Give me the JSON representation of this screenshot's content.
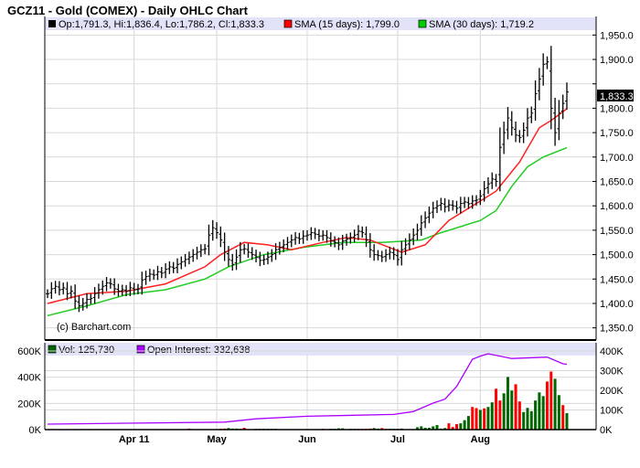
{
  "chart_data": {
    "type": "ohlc",
    "title": "GCZ11 - Gold (COMEX) - Daily OHLC Chart",
    "watermark": "(c) Barchart.com",
    "legend": {
      "ohlc": "Op:1,791.3, Hi:1,836.4, Lo:1,786.2, Cl:1,833.3",
      "sma15": "SMA (15 days): 1,799.0",
      "sma30": "SMA (30 days): 1,719.2",
      "vol": "Vol: 125,730",
      "oi": "Open Interest: 332,638"
    },
    "last_price_label": "1,833.3",
    "last_price": 1833.3,
    "price_ylim": [
      1325,
      1960
    ],
    "price_ticks": [
      1350,
      1400,
      1450,
      1500,
      1550,
      1600,
      1650,
      1700,
      1750,
      1800,
      1850,
      1900,
      1950
    ],
    "price_tick_labels": [
      "1,350.0",
      "1,400.0",
      "1,450.0",
      "1,500.0",
      "1,550.0",
      "1,600.0",
      "1,650.0",
      "1,700.0",
      "1,750.0",
      "1,800.0",
      "",
      "1,900.0",
      "1,950.0"
    ],
    "x_labels": [
      {
        "label": "Apr 11",
        "index": 22
      },
      {
        "label": "May",
        "index": 43
      },
      {
        "label": "Jun",
        "index": 66
      },
      {
        "label": "Jul",
        "index": 89
      },
      {
        "label": "Aug",
        "index": 110
      }
    ],
    "closes": [
      1420,
      1430,
      1435,
      1428,
      1432,
      1420,
      1425,
      1405,
      1395,
      1400,
      1408,
      1410,
      1420,
      1428,
      1435,
      1442,
      1440,
      1430,
      1425,
      1428,
      1425,
      1432,
      1428,
      1430,
      1448,
      1455,
      1460,
      1458,
      1465,
      1462,
      1470,
      1475,
      1472,
      1480,
      1485,
      1490,
      1495,
      1500,
      1505,
      1510,
      1512,
      1540,
      1555,
      1545,
      1530,
      1505,
      1490,
      1480,
      1495,
      1510,
      1512,
      1505,
      1500,
      1495,
      1488,
      1490,
      1495,
      1500,
      1510,
      1515,
      1520,
      1525,
      1530,
      1535,
      1532,
      1538,
      1540,
      1545,
      1542,
      1538,
      1540,
      1535,
      1528,
      1525,
      1520,
      1528,
      1532,
      1535,
      1540,
      1548,
      1545,
      1530,
      1510,
      1500,
      1498,
      1495,
      1500,
      1505,
      1500,
      1490,
      1510,
      1520,
      1530,
      1540,
      1550,
      1565,
      1575,
      1585,
      1595,
      1600,
      1605,
      1598,
      1602,
      1600,
      1595,
      1605,
      1608,
      1604,
      1610,
      1612,
      1620,
      1635,
      1645,
      1655,
      1650,
      1720,
      1750,
      1780,
      1760,
      1745,
      1740,
      1755,
      1780,
      1790,
      1830,
      1860,
      1890,
      1895,
      1800,
      1750,
      1790,
      1810,
      1833.3
    ],
    "bar_half_range": 9,
    "sma15": [
      [
        0,
        1400
      ],
      [
        10,
        1420
      ],
      [
        20,
        1425
      ],
      [
        30,
        1440
      ],
      [
        40,
        1475
      ],
      [
        44,
        1500
      ],
      [
        50,
        1525
      ],
      [
        56,
        1520
      ],
      [
        62,
        1510
      ],
      [
        70,
        1525
      ],
      [
        76,
        1535
      ],
      [
        82,
        1530
      ],
      [
        90,
        1505
      ],
      [
        96,
        1520
      ],
      [
        102,
        1570
      ],
      [
        108,
        1600
      ],
      [
        114,
        1630
      ],
      [
        120,
        1690
      ],
      [
        125,
        1760
      ],
      [
        128,
        1775
      ],
      [
        132,
        1799
      ]
    ],
    "sma30": [
      [
        0,
        1375
      ],
      [
        10,
        1395
      ],
      [
        20,
        1418
      ],
      [
        30,
        1428
      ],
      [
        40,
        1450
      ],
      [
        46,
        1475
      ],
      [
        55,
        1500
      ],
      [
        65,
        1515
      ],
      [
        75,
        1525
      ],
      [
        85,
        1525
      ],
      [
        95,
        1530
      ],
      [
        100,
        1545
      ],
      [
        110,
        1570
      ],
      [
        114,
        1590
      ],
      [
        118,
        1640
      ],
      [
        122,
        1680
      ],
      [
        126,
        1700
      ],
      [
        132,
        1719.2
      ]
    ],
    "volume_ylim_k": [
      0,
      600
    ],
    "volume_ticks": [
      "0K",
      "200K",
      "400K",
      "600K"
    ],
    "oi_ylim_k": [
      0,
      400
    ],
    "oi_ticks": [
      "0K",
      "100K",
      "200K",
      "300K",
      "400K"
    ],
    "volume_k": [
      [
        36,
        8,
        "r"
      ],
      [
        44,
        6,
        "r"
      ],
      [
        45,
        8,
        "r"
      ],
      [
        46,
        12,
        "g"
      ],
      [
        47,
        8,
        "g"
      ],
      [
        48,
        8,
        "g"
      ],
      [
        49,
        6,
        "r"
      ],
      [
        50,
        14,
        "r"
      ],
      [
        53,
        6,
        "r"
      ],
      [
        54,
        6,
        "g"
      ],
      [
        55,
        6,
        "g"
      ],
      [
        56,
        6,
        "g"
      ],
      [
        57,
        6,
        "g"
      ],
      [
        58,
        6,
        "g"
      ],
      [
        70,
        6,
        "r"
      ],
      [
        72,
        6,
        "g"
      ],
      [
        73,
        6,
        "g"
      ],
      [
        74,
        10,
        "g"
      ],
      [
        75,
        10,
        "g"
      ],
      [
        77,
        6,
        "g"
      ],
      [
        78,
        6,
        "g"
      ],
      [
        79,
        6,
        "r"
      ],
      [
        80,
        6,
        "r"
      ],
      [
        81,
        6,
        "r"
      ],
      [
        82,
        8,
        "r"
      ],
      [
        83,
        12,
        "g"
      ],
      [
        84,
        8,
        "g"
      ],
      [
        85,
        12,
        "r"
      ],
      [
        86,
        6,
        "r"
      ],
      [
        87,
        6,
        "g"
      ],
      [
        88,
        6,
        "g"
      ],
      [
        89,
        6,
        "g"
      ],
      [
        90,
        8,
        "g"
      ],
      [
        94,
        18,
        "g"
      ],
      [
        95,
        25,
        "g"
      ],
      [
        96,
        14,
        "g"
      ],
      [
        97,
        14,
        "g"
      ],
      [
        98,
        25,
        "g"
      ],
      [
        99,
        35,
        "g"
      ],
      [
        100,
        8,
        "g"
      ],
      [
        101,
        12,
        "g"
      ],
      [
        102,
        48,
        "r"
      ],
      [
        103,
        20,
        "r"
      ],
      [
        104,
        42,
        "r"
      ],
      [
        105,
        48,
        "g"
      ],
      [
        106,
        72,
        "g"
      ],
      [
        107,
        104,
        "g"
      ],
      [
        108,
        173,
        "r"
      ],
      [
        109,
        164,
        "r"
      ],
      [
        110,
        150,
        "g"
      ],
      [
        111,
        162,
        "r"
      ],
      [
        112,
        173,
        "g"
      ],
      [
        113,
        208,
        "g"
      ],
      [
        114,
        312,
        "r"
      ],
      [
        115,
        222,
        "r"
      ],
      [
        116,
        277,
        "g"
      ],
      [
        117,
        402,
        "g"
      ],
      [
        118,
        298,
        "g"
      ],
      [
        119,
        346,
        "r"
      ],
      [
        120,
        215,
        "r"
      ],
      [
        121,
        134,
        "g"
      ],
      [
        122,
        166,
        "g"
      ],
      [
        123,
        141,
        "g"
      ],
      [
        124,
        222,
        "g"
      ],
      [
        125,
        284,
        "g"
      ],
      [
        126,
        256,
        "g"
      ],
      [
        127,
        367,
        "r"
      ],
      [
        128,
        443,
        "r"
      ],
      [
        129,
        388,
        "g"
      ],
      [
        130,
        263,
        "g"
      ],
      [
        131,
        187,
        "r"
      ],
      [
        132,
        125.73,
        "g"
      ]
    ],
    "open_interest_k": [
      [
        0,
        28
      ],
      [
        45,
        38
      ],
      [
        53,
        55
      ],
      [
        66,
        68
      ],
      [
        88,
        77
      ],
      [
        93,
        92
      ],
      [
        98,
        135
      ],
      [
        101,
        155
      ],
      [
        104,
        220
      ],
      [
        108,
        358
      ],
      [
        110,
        374
      ],
      [
        112,
        386
      ],
      [
        118,
        362
      ],
      [
        127,
        369
      ],
      [
        131,
        335
      ],
      [
        132,
        332.6
      ]
    ]
  },
  "colors": {
    "up": "#006600",
    "down": "#ff0000",
    "sma15": "#ff2020",
    "sma30": "#22cc22",
    "oi": "#aa00ff",
    "legend_bg": "#e2e2f8",
    "grid": "#d8d8d8"
  }
}
